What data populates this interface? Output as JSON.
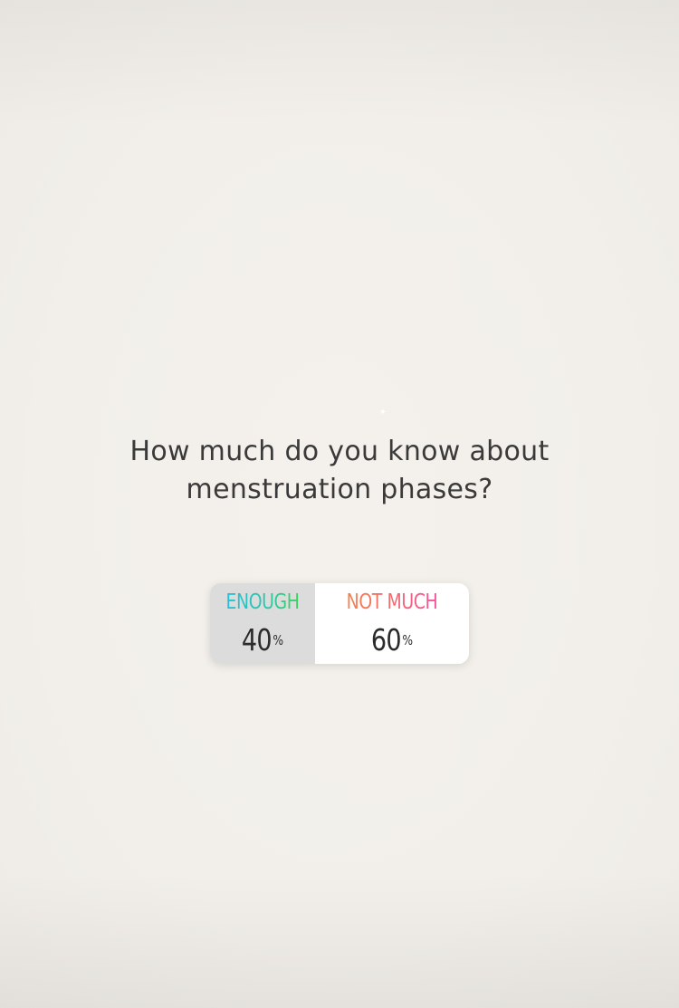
{
  "story": {
    "question_line1": "How much do you know about",
    "question_line2": "menstruation phases?"
  },
  "poll": {
    "options": [
      {
        "label": "ENOUGH",
        "percent": "40",
        "percent_sign": "%",
        "share": 0.4
      },
      {
        "label": "NOT MUCH",
        "percent": "60",
        "percent_sign": "%",
        "share": 0.6
      }
    ]
  },
  "colors": {
    "background": "#f3f0eb",
    "question_text": "#3a3a3a",
    "option1_gradient": [
      "#25bde0",
      "#3fd44e"
    ],
    "option2_gradient": [
      "#f8893d",
      "#f04baa"
    ],
    "option1_fill": "#dcdcdc",
    "option2_fill": "#ffffff"
  },
  "icons": {
    "sparkle": "sparkle-icon"
  }
}
